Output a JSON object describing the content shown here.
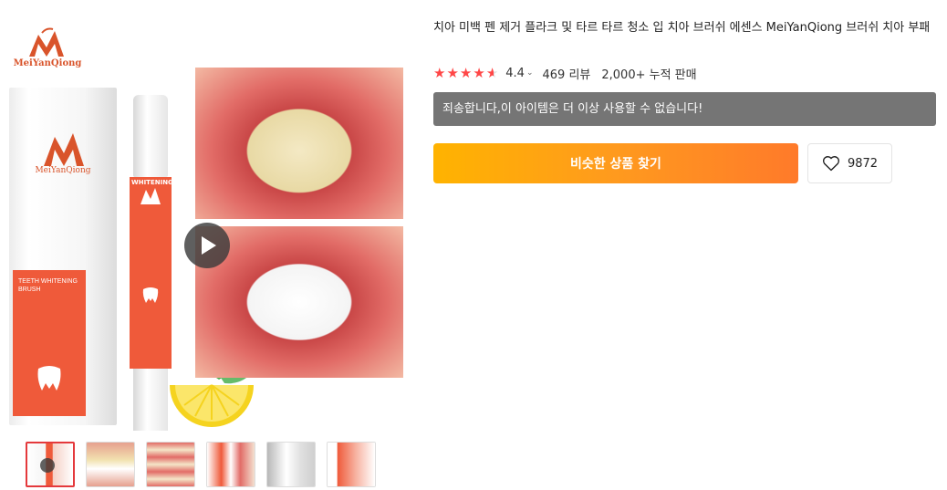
{
  "product": {
    "title": "치아 미백 펜 제거 플라크 및 타르 타르 청소 입 치아 브러쉬 에센스 MeiYanQiong 브러쉬 치아 부패",
    "brand": "MeiYanQiong",
    "rating": {
      "value": "4.4",
      "stars": 4.4,
      "reviews": "469 리뷰",
      "sold": "2,000+ 누적 판매"
    },
    "unavailable_notice": "죄송합니다,이 아이템은 더 이상 사용할 수 없습니다!",
    "find_similar_label": "비슷한 상품 찾기",
    "wishlist_count": "9872"
  },
  "gallery": {
    "box_brand": "MeiYanQiong",
    "box_panel_title": "TEETH WHITENING BRUSH",
    "pen_label": "WHITENING",
    "pen_brand": "MeiYanQiong",
    "thumbnails_count": 6,
    "active_thumbnail": 0
  },
  "colors": {
    "accent": "#ff4747",
    "brand": "#d9542b",
    "button_start": "#ffb300",
    "button_end": "#ff7a2a",
    "notice_bg": "#757575"
  }
}
